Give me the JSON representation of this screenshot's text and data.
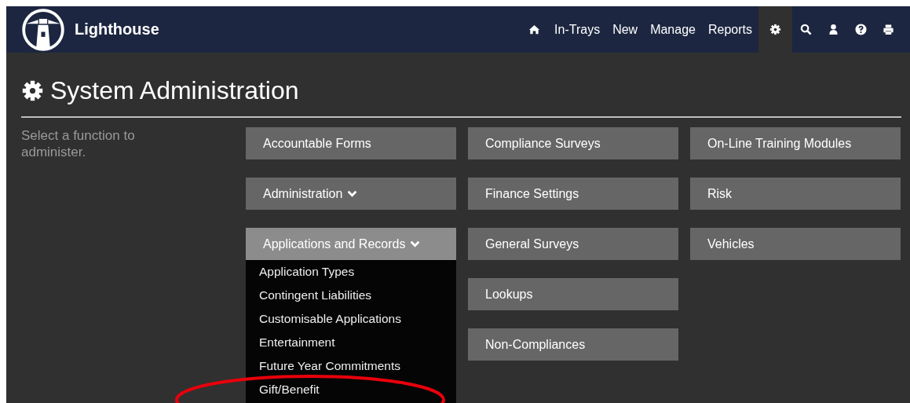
{
  "brand": {
    "name": "Lighthouse"
  },
  "nav": [
    {
      "kind": "home",
      "selected": false
    },
    {
      "kind": "link",
      "label": "In-Trays",
      "selected": false
    },
    {
      "kind": "link",
      "label": "New",
      "selected": false
    },
    {
      "kind": "link",
      "label": "Manage",
      "selected": false
    },
    {
      "kind": "link",
      "label": "Reports",
      "selected": false
    },
    {
      "kind": "gear",
      "selected": true
    },
    {
      "kind": "search",
      "selected": false
    },
    {
      "kind": "user",
      "selected": false
    },
    {
      "kind": "help",
      "selected": false
    },
    {
      "kind": "print",
      "selected": false
    }
  ],
  "page_title": "System Administration",
  "intro": "Select a function to administer.",
  "columns": [
    [
      {
        "kind": "link",
        "label": "Accountable Forms"
      },
      {
        "kind": "dropdown",
        "label": "Administration",
        "expanded": false
      },
      {
        "kind": "dropdown",
        "label": "Applications and Records",
        "expanded": true,
        "items": [
          "Application Types",
          "Contingent Liabilities",
          "Customisable Applications",
          "Entertainment",
          "Future Year Commitments",
          "Gift/Benefit"
        ]
      }
    ],
    [
      {
        "kind": "link",
        "label": "Compliance Surveys"
      },
      {
        "kind": "link",
        "label": "Finance Settings"
      },
      {
        "kind": "link",
        "label": "General Surveys"
      },
      {
        "kind": "link",
        "label": "Lookups"
      },
      {
        "kind": "link",
        "label": "Non-Compliances"
      }
    ],
    [
      {
        "kind": "link",
        "label": "On-Line Training Modules"
      },
      {
        "kind": "link",
        "label": "Risk"
      },
      {
        "kind": "link",
        "label": "Vehicles"
      }
    ]
  ],
  "annotations": [
    {
      "kind": "ellipse"
    }
  ]
}
